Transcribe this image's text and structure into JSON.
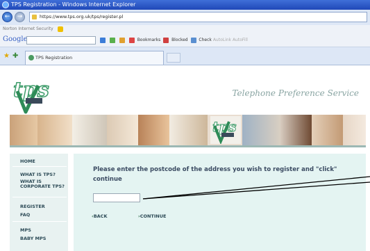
{
  "browser": {
    "window_title": "TPS Registration - Windows Internet Explorer",
    "address": "https://www.tps.org.uk/tps/register.pl",
    "menu_text": "Norton Internet Security",
    "google_label": "Google",
    "toolbar_items": [
      "Bookmarks",
      "Blocked",
      "Check",
      "AutoLink",
      "AutoFill"
    ],
    "tab_title": "TPS Registration"
  },
  "site": {
    "tagline": "Telephone Preference Service",
    "logo_text": "tps",
    "colors": {
      "accent": "#2e8b57",
      "panel": "#e4f4f2",
      "nav": "#e8f2f1"
    }
  },
  "nav": {
    "home": "HOME",
    "what_is_tps": "WHAT IS TPS?",
    "what_is_corporate": "WHAT IS CORPORATE TPS?",
    "register": "REGISTER",
    "faq": "FAQ",
    "mps": "MPS",
    "baby_mps": "BABY MPS"
  },
  "form": {
    "instructions": "Please enter the postcode of the address you wish to register and \"click\" continue",
    "postcode_value": "",
    "postcode_placeholder": "",
    "back_label": "BACK",
    "continue_label": "CONTINUE"
  }
}
